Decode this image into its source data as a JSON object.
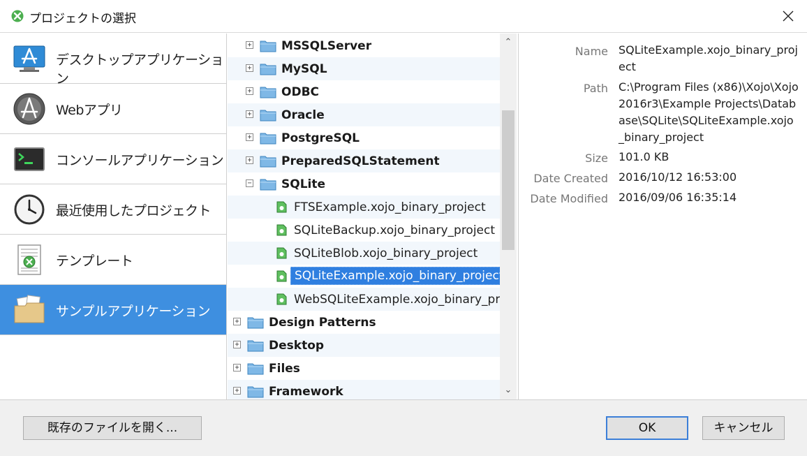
{
  "window": {
    "title": "プロジェクトの選択"
  },
  "categories": [
    {
      "label": "デスクトップアプリケーション",
      "icon": "desktop-app-icon"
    },
    {
      "label": "Webアプリ",
      "icon": "web-app-icon"
    },
    {
      "label": "コンソールアプリケーション",
      "icon": "console-app-icon"
    },
    {
      "label": "最近使用したプロジェクト",
      "icon": "clock-icon"
    },
    {
      "label": "テンプレート",
      "icon": "template-icon"
    },
    {
      "label": "サンプルアプリケーション",
      "icon": "sample-folder-icon",
      "selected": true
    }
  ],
  "tree": {
    "folders_nested": [
      "MSSQLServer",
      "MySQL",
      "ODBC",
      "Oracle",
      "PostgreSQL",
      "PreparedSQLStatement",
      "SQLite"
    ],
    "files": [
      "FTSExample.xojo_binary_project",
      "SQLiteBackup.xojo_binary_project",
      "SQLiteBlob.xojo_binary_project",
      "SQLiteExample.xojo_binary_project",
      "WebSQLiteExample.xojo_binary_pr..."
    ],
    "folders_top": [
      "Design Patterns",
      "Desktop",
      "Files",
      "Framework"
    ]
  },
  "details": {
    "name_label": "Name",
    "name_value": "SQLiteExample.xojo_binary_project",
    "path_label": "Path",
    "path_value": "C:\\Program Files (x86)\\Xojo\\Xojo 2016r3\\Example Projects\\Database\\SQLite\\SQLiteExample.xojo_binary_project",
    "size_label": "Size",
    "size_value": "101.0 KB",
    "created_label": "Date Created",
    "created_value": "2016/10/12 16:53:00",
    "modified_label": "Date Modified",
    "modified_value": "2016/09/06 16:35:14"
  },
  "footer": {
    "open_existing": "既存のファイルを開く...",
    "ok": "OK",
    "cancel": "キャンセル"
  },
  "colors": {
    "selection": "#3e8fe0",
    "accent_default_button": "#3c7fd8"
  }
}
